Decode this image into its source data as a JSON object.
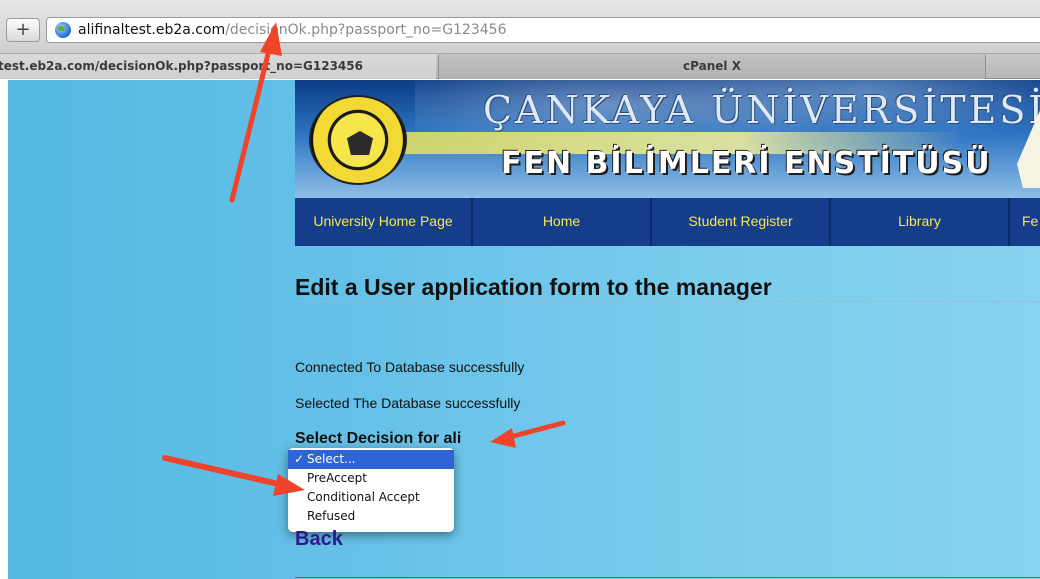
{
  "browser": {
    "add_tab_symbol": "+",
    "url_host": "alifinaltest.eb2a.com",
    "url_rest": "/decisionOk.php?passport_no=G123456",
    "tabs": [
      {
        "label": "test.eb2a.com/decisionOk.php?passport_no=G123456",
        "active": true
      },
      {
        "label": "cPanel X",
        "active": false
      }
    ]
  },
  "banner": {
    "title": "ÇANKAYA ÜNİVERSİTESİ",
    "subtitle": "FEN BİLİMLERİ ENSTİTÜSÜ",
    "logo": "university-seal"
  },
  "nav": {
    "items": [
      "University Home Page",
      "Home",
      "Student Register",
      "Library",
      "Fe"
    ]
  },
  "main": {
    "heading": "Edit a User application form to the manager",
    "status_connected": "Connected To Database successfully",
    "status_selected": "Selected The Database successfully",
    "select_label": "Select Decision for ali",
    "decision_select": {
      "check": "✓",
      "options": [
        "Select...",
        "PreAccept",
        "Conditional Accept",
        "Refused"
      ],
      "selected_index": 0
    },
    "back_link": "Back"
  },
  "colors": {
    "nav_bg": "#153d8c",
    "nav_text": "#f3e85a",
    "page_bg": "#66c1e8",
    "annotation_arrow": "#f0442a",
    "selection_highlight": "#2f64d6",
    "back_link": "#2c1a8d"
  }
}
